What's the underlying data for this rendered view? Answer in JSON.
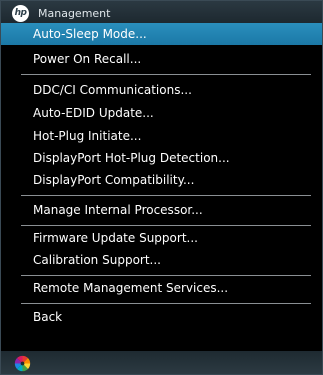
{
  "header": {
    "logo_text": "hp",
    "title": "Management"
  },
  "menu": {
    "items": [
      {
        "label": "Auto-Sleep Mode..."
      },
      {
        "label": "Power On Recall..."
      },
      {
        "label": "DDC/CI Communications..."
      },
      {
        "label": "Auto-EDID Update..."
      },
      {
        "label": "Hot-Plug Initiate..."
      },
      {
        "label": "DisplayPort Hot-Plug Detection..."
      },
      {
        "label": "DisplayPort Compatibility..."
      },
      {
        "label": "Manage Internal Processor..."
      },
      {
        "label": "Firmware Update Support..."
      },
      {
        "label": "Calibration Support..."
      },
      {
        "label": "Remote Management Services..."
      },
      {
        "label": "Back"
      }
    ],
    "selected_label": "Auto-Sleep Mode..."
  },
  "footer": {
    "icon": "pinwheel-icon"
  },
  "colors": {
    "highlight": "#1f82b1",
    "header_bg": "#2b3942",
    "text": "#ffffff"
  }
}
